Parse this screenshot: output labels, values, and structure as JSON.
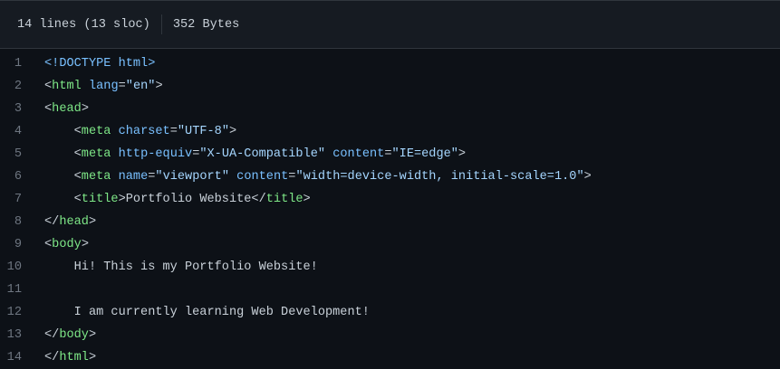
{
  "header": {
    "lines": "14 lines (13 sloc)",
    "size": "352 Bytes"
  },
  "colors": {
    "background": "#0d1117",
    "header": "#161b22",
    "tag": "#7ee787",
    "attr": "#79c0ff",
    "string": "#a5d6ff",
    "text": "#c9d1d9",
    "line_number": "#6e7681"
  },
  "code": [
    {
      "n": "1",
      "t": [
        [
          "doc",
          "<!DOCTYPE html>"
        ]
      ]
    },
    {
      "n": "2",
      "t": [
        [
          "txt",
          "<"
        ],
        [
          "tag",
          "html"
        ],
        [
          "txt",
          " "
        ],
        [
          "attr",
          "lang"
        ],
        [
          "txt",
          "="
        ],
        [
          "str",
          "\"en\""
        ],
        [
          "txt",
          ">"
        ]
      ]
    },
    {
      "n": "3",
      "t": [
        [
          "txt",
          "<"
        ],
        [
          "tag",
          "head"
        ],
        [
          "txt",
          ">"
        ]
      ]
    },
    {
      "n": "4",
      "t": [
        [
          "txt",
          "    <"
        ],
        [
          "tag",
          "meta"
        ],
        [
          "txt",
          " "
        ],
        [
          "attr",
          "charset"
        ],
        [
          "txt",
          "="
        ],
        [
          "str",
          "\"UTF-8\""
        ],
        [
          "txt",
          ">"
        ]
      ]
    },
    {
      "n": "5",
      "t": [
        [
          "txt",
          "    <"
        ],
        [
          "tag",
          "meta"
        ],
        [
          "txt",
          " "
        ],
        [
          "attr",
          "http-equiv"
        ],
        [
          "txt",
          "="
        ],
        [
          "str",
          "\"X-UA-Compatible\""
        ],
        [
          "txt",
          " "
        ],
        [
          "attr",
          "content"
        ],
        [
          "txt",
          "="
        ],
        [
          "str",
          "\"IE=edge\""
        ],
        [
          "txt",
          ">"
        ]
      ]
    },
    {
      "n": "6",
      "t": [
        [
          "txt",
          "    <"
        ],
        [
          "tag",
          "meta"
        ],
        [
          "txt",
          " "
        ],
        [
          "attr",
          "name"
        ],
        [
          "txt",
          "="
        ],
        [
          "str",
          "\"viewport\""
        ],
        [
          "txt",
          " "
        ],
        [
          "attr",
          "content"
        ],
        [
          "txt",
          "="
        ],
        [
          "str",
          "\"width=device-width, initial-scale=1.0\""
        ],
        [
          "txt",
          ">"
        ]
      ]
    },
    {
      "n": "7",
      "t": [
        [
          "txt",
          "    <"
        ],
        [
          "tag",
          "title"
        ],
        [
          "txt",
          ">Portfolio Website</"
        ],
        [
          "tag",
          "title"
        ],
        [
          "txt",
          ">"
        ]
      ]
    },
    {
      "n": "8",
      "t": [
        [
          "txt",
          "</"
        ],
        [
          "tag",
          "head"
        ],
        [
          "txt",
          ">"
        ]
      ]
    },
    {
      "n": "9",
      "t": [
        [
          "txt",
          "<"
        ],
        [
          "tag",
          "body"
        ],
        [
          "txt",
          ">"
        ]
      ]
    },
    {
      "n": "10",
      "t": [
        [
          "txt",
          "    Hi! This is my Portfolio Website!"
        ]
      ]
    },
    {
      "n": "11",
      "t": []
    },
    {
      "n": "12",
      "t": [
        [
          "txt",
          "    I am currently learning Web Development!"
        ]
      ]
    },
    {
      "n": "13",
      "t": [
        [
          "txt",
          "</"
        ],
        [
          "tag",
          "body"
        ],
        [
          "txt",
          ">"
        ]
      ]
    },
    {
      "n": "14",
      "t": [
        [
          "txt",
          "</"
        ],
        [
          "tag",
          "html"
        ],
        [
          "txt",
          ">"
        ]
      ]
    }
  ]
}
